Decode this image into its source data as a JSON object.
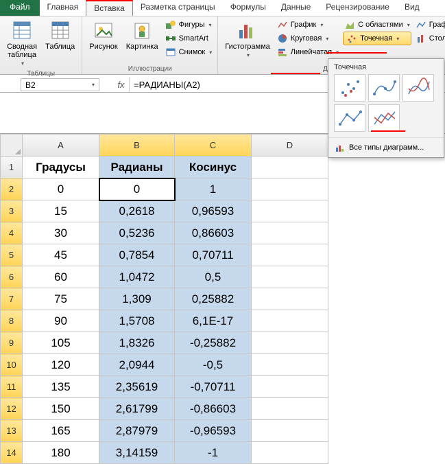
{
  "tabs": {
    "file": "Файл",
    "home": "Главная",
    "insert": "Вставка",
    "layout": "Разметка страницы",
    "formulas": "Формулы",
    "data": "Данные",
    "review": "Рецензирование",
    "view": "Вид"
  },
  "ribbon": {
    "tables": {
      "label": "Таблицы",
      "pivot": "Сводная\nтаблица",
      "table": "Таблица"
    },
    "illustrations": {
      "label": "Иллюстрации",
      "picture": "Рисунок",
      "image": "Картинка",
      "shapes": "Фигуры",
      "smartart": "SmartArt",
      "screenshot": "Снимок"
    },
    "charts": {
      "label": "Диаграммы",
      "histogram": "Гистограмма",
      "line": "График",
      "pie": "Круговая",
      "bar": "Линейчатая",
      "area": "С областями",
      "scatter": "Точечная",
      "other_graph": "График",
      "stock": "Столбец"
    },
    "scatter_panel": {
      "title": "Точечная",
      "all_types": "Все типы диаграмм..."
    }
  },
  "formula_bar": {
    "name_box": "B2",
    "formula": "=РАДИАНЫ(A2)"
  },
  "grid": {
    "col_headers": [
      "A",
      "B",
      "C",
      "D"
    ],
    "row_headers": [
      "1",
      "2",
      "3",
      "4",
      "5",
      "6",
      "7",
      "8",
      "9",
      "10",
      "11",
      "12",
      "13",
      "14"
    ],
    "header_row": {
      "a": "Градусы",
      "b": "Радианы",
      "c": "Косинус"
    },
    "rows": [
      {
        "a": "0",
        "b": "0",
        "c": "1"
      },
      {
        "a": "15",
        "b": "0,2618",
        "c": "0,96593"
      },
      {
        "a": "30",
        "b": "0,5236",
        "c": "0,86603"
      },
      {
        "a": "45",
        "b": "0,7854",
        "c": "0,70711"
      },
      {
        "a": "60",
        "b": "1,0472",
        "c": "0,5"
      },
      {
        "a": "75",
        "b": "1,309",
        "c": "0,25882"
      },
      {
        "a": "90",
        "b": "1,5708",
        "c": "6,1E-17"
      },
      {
        "a": "105",
        "b": "1,8326",
        "c": "-0,25882"
      },
      {
        "a": "120",
        "b": "2,0944",
        "c": "-0,5"
      },
      {
        "a": "135",
        "b": "2,35619",
        "c": "-0,70711"
      },
      {
        "a": "150",
        "b": "2,61799",
        "c": "-0,86603"
      },
      {
        "a": "165",
        "b": "2,87979",
        "c": "-0,96593"
      },
      {
        "a": "180",
        "b": "3,14159",
        "c": "-1"
      }
    ]
  },
  "chart_data": {
    "type": "table",
    "title": "Градусы / Радианы / Косинус",
    "columns": [
      "Градусы",
      "Радианы",
      "Косинус"
    ],
    "data": [
      [
        0,
        0,
        1
      ],
      [
        15,
        0.2618,
        0.96593
      ],
      [
        30,
        0.5236,
        0.86603
      ],
      [
        45,
        0.7854,
        0.70711
      ],
      [
        60,
        1.0472,
        0.5
      ],
      [
        75,
        1.309,
        0.25882
      ],
      [
        90,
        1.5708,
        6.1e-17
      ],
      [
        105,
        1.8326,
        -0.25882
      ],
      [
        120,
        2.0944,
        -0.5
      ],
      [
        135,
        2.35619,
        -0.70711
      ],
      [
        150,
        2.61799,
        -0.86603
      ],
      [
        165,
        2.87979,
        -0.96593
      ],
      [
        180,
        3.14159,
        -1
      ]
    ]
  }
}
